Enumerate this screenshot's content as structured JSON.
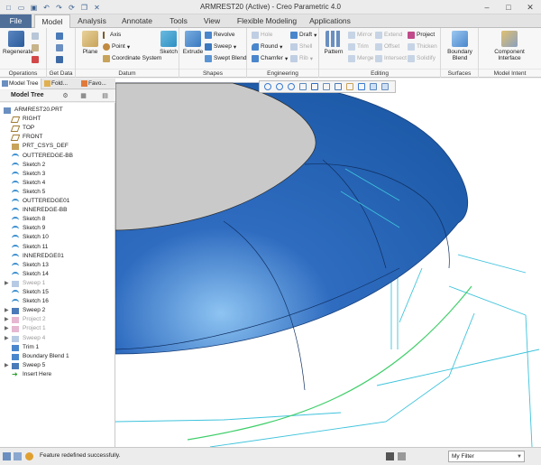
{
  "window": {
    "title": "ARMREST20 (Active) - Creo Parametric 4.0",
    "controls": [
      "minimize",
      "maximize",
      "close"
    ]
  },
  "quick_access": [
    "new-icon",
    "open-icon",
    "save-icon",
    "undo-icon",
    "redo-icon",
    "regenerate-icon",
    "windows-icon",
    "close-window-icon"
  ],
  "tabs": [
    "File",
    "Model",
    "Analysis",
    "Annotate",
    "Tools",
    "View",
    "Flexible Modeling",
    "Applications"
  ],
  "active_tab": "Model",
  "ribbon": {
    "operations": {
      "label": "Operations",
      "regenerate": "Regenerate"
    },
    "get_data": {
      "label": "Get Data"
    },
    "datum": {
      "label": "Datum",
      "plane": "Plane",
      "axis": "Axis",
      "point": "Point",
      "csys": "Coordinate System",
      "sketch": "Sketch"
    },
    "shapes": {
      "label": "Shapes",
      "extrude": "Extrude",
      "revolve": "Revolve",
      "sweep": "Sweep",
      "swept_blend": "Swept Blend"
    },
    "engineering": {
      "label": "Engineering",
      "hole": "Hole",
      "round": "Round",
      "chamfer": "Chamfer",
      "draft": "Draft",
      "shell": "Shell",
      "rib": "Rib"
    },
    "editing": {
      "label": "Editing",
      "pattern": "Pattern",
      "mirror": "Mirror",
      "trim": "Trim",
      "merge": "Merge",
      "extend": "Extend",
      "offset": "Offset",
      "intersect": "Intersect",
      "project": "Project",
      "thicken": "Thicken",
      "solidify": "Solidify"
    },
    "surfaces": {
      "label": "Surfaces",
      "boundary_blend": "Boundary Blend"
    },
    "model_intent": {
      "label": "Model Intent",
      "component_interface": "Component Interface"
    }
  },
  "panel_tabs": [
    "Model Tree",
    "Fold...",
    "Favo..."
  ],
  "tree": {
    "header": "Model Tree",
    "items": [
      {
        "label": "ARMREST20.PRT",
        "type": "part",
        "expand": "",
        "suppressed": false,
        "indent": 0
      },
      {
        "label": "RIGHT",
        "type": "plane",
        "expand": "",
        "suppressed": false,
        "indent": 1
      },
      {
        "label": "TOP",
        "type": "plane",
        "expand": "",
        "suppressed": false,
        "indent": 1
      },
      {
        "label": "FRONT",
        "type": "plane",
        "expand": "",
        "suppressed": false,
        "indent": 1
      },
      {
        "label": "PRT_CSYS_DEF",
        "type": "csys",
        "expand": "",
        "suppressed": false,
        "indent": 1
      },
      {
        "label": "OUTTEREDGE-BB",
        "type": "sketch",
        "expand": "",
        "suppressed": false,
        "indent": 1
      },
      {
        "label": "Sketch 2",
        "type": "sketch",
        "expand": "",
        "suppressed": false,
        "indent": 1
      },
      {
        "label": "Sketch 3",
        "type": "sketch",
        "expand": "",
        "suppressed": false,
        "indent": 1
      },
      {
        "label": "Sketch 4",
        "type": "sketch",
        "expand": "",
        "suppressed": false,
        "indent": 1
      },
      {
        "label": "Sketch 5",
        "type": "sketch",
        "expand": "",
        "suppressed": false,
        "indent": 1
      },
      {
        "label": "OUTTEREDGE01",
        "type": "sketch",
        "expand": "",
        "suppressed": false,
        "indent": 1
      },
      {
        "label": "INNEREDGE-BB",
        "type": "sketch",
        "expand": "",
        "suppressed": false,
        "indent": 1
      },
      {
        "label": "Sketch 8",
        "type": "sketch",
        "expand": "",
        "suppressed": false,
        "indent": 1
      },
      {
        "label": "Sketch 9",
        "type": "sketch",
        "expand": "",
        "suppressed": false,
        "indent": 1
      },
      {
        "label": "Sketch 10",
        "type": "sketch",
        "expand": "",
        "suppressed": false,
        "indent": 1
      },
      {
        "label": "Sketch 11",
        "type": "sketch",
        "expand": "",
        "suppressed": false,
        "indent": 1
      },
      {
        "label": "INNEREDGE01",
        "type": "sketch",
        "expand": "",
        "suppressed": false,
        "indent": 1
      },
      {
        "label": "Sketch 13",
        "type": "sketch",
        "expand": "",
        "suppressed": false,
        "indent": 1
      },
      {
        "label": "Sketch 14",
        "type": "sketch",
        "expand": "",
        "suppressed": false,
        "indent": 1
      },
      {
        "label": "Sweep 1",
        "type": "sweep",
        "expand": "▶",
        "suppressed": true,
        "indent": 1
      },
      {
        "label": "Sketch 15",
        "type": "sketch",
        "expand": "",
        "suppressed": false,
        "indent": 1
      },
      {
        "label": "Sketch 16",
        "type": "sketch",
        "expand": "",
        "suppressed": false,
        "indent": 1
      },
      {
        "label": "Sweep 2",
        "type": "sweep",
        "expand": "▶",
        "suppressed": false,
        "indent": 1
      },
      {
        "label": "Project 2",
        "type": "project",
        "expand": "▶",
        "suppressed": true,
        "indent": 1
      },
      {
        "label": "Project 1",
        "type": "project",
        "expand": "▶",
        "suppressed": true,
        "indent": 1
      },
      {
        "label": "Sweep 4",
        "type": "sweep",
        "expand": "▶",
        "suppressed": true,
        "indent": 1
      },
      {
        "label": "Trim 1",
        "type": "trim",
        "expand": "",
        "suppressed": false,
        "indent": 1
      },
      {
        "label": "Boundary Blend 1",
        "type": "blend",
        "expand": "",
        "suppressed": false,
        "indent": 1
      },
      {
        "label": "Sweep 5",
        "type": "sweep",
        "expand": "▶",
        "suppressed": false,
        "indent": 1
      },
      {
        "label": "Insert Here",
        "type": "insert",
        "expand": "",
        "suppressed": false,
        "indent": 1
      }
    ]
  },
  "view_toolbar": [
    "refit-icon",
    "zoom-in-icon",
    "zoom-out-icon",
    "repaint-icon",
    "display-style-icon",
    "saved-orientations-icon",
    "view-manager-icon",
    "datum-display-icon",
    "spin-center-icon",
    "annotation-display-icon",
    "named-views-icon"
  ],
  "status": {
    "message": "Feature redefined successfully.",
    "filter": "My Filter"
  },
  "colors": {
    "surface_blue": "#2f6cc0",
    "surface_highlight": "#8ec4f2",
    "cap_gray": "#c9c9c9",
    "curve_cyan": "#3ec3dc",
    "curve_green": "#3fce6a",
    "file_tab": "#4f6f98"
  }
}
